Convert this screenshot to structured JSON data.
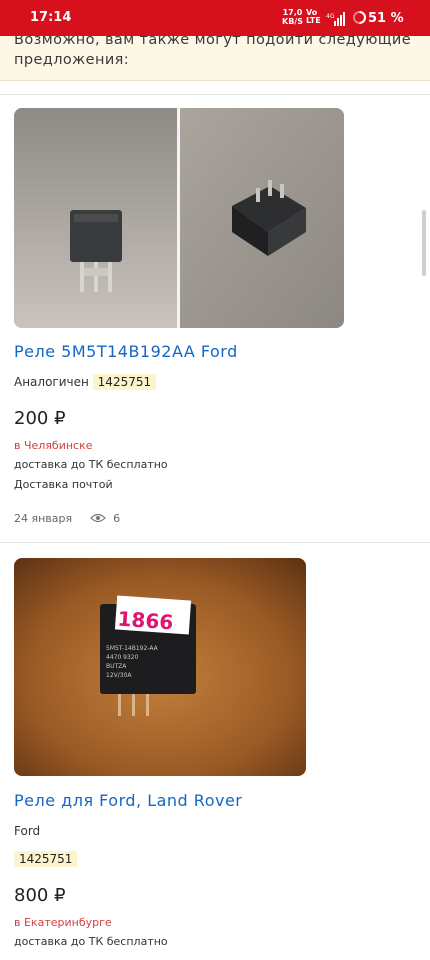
{
  "status": {
    "time": "17:14",
    "net_rate": "17,0",
    "net_unit": "KB/S",
    "volte_top": "Vo",
    "volte_bottom": "LTE",
    "network": "4G",
    "battery": "51 %"
  },
  "notice": {
    "text": "Возможно, вам также могут подойти следующие предложения:"
  },
  "listings": [
    {
      "title": "Реле 5M5T14B192AA Ford",
      "analog_label": "Аналогичен",
      "analog_code": "1425751",
      "price": "200 ₽",
      "city": "в Челябинске",
      "delivery": "доставка до ТК бесплатно",
      "post": "Доставка почтой",
      "date": "24 января",
      "views": "6"
    },
    {
      "title": "Реле для Ford,  Land Rover",
      "brand": "Ford",
      "code": "1425751",
      "price": "800 ₽",
      "city": "в Екатеринбурге",
      "delivery": "доставка до ТК бесплатно",
      "photo_marker": "1866",
      "photo_label_1": "5M5T-14B192-AA",
      "photo_label_2": "4470 9320",
      "photo_label_3": "BUTZA",
      "photo_label_4": "12V/30A"
    }
  ]
}
